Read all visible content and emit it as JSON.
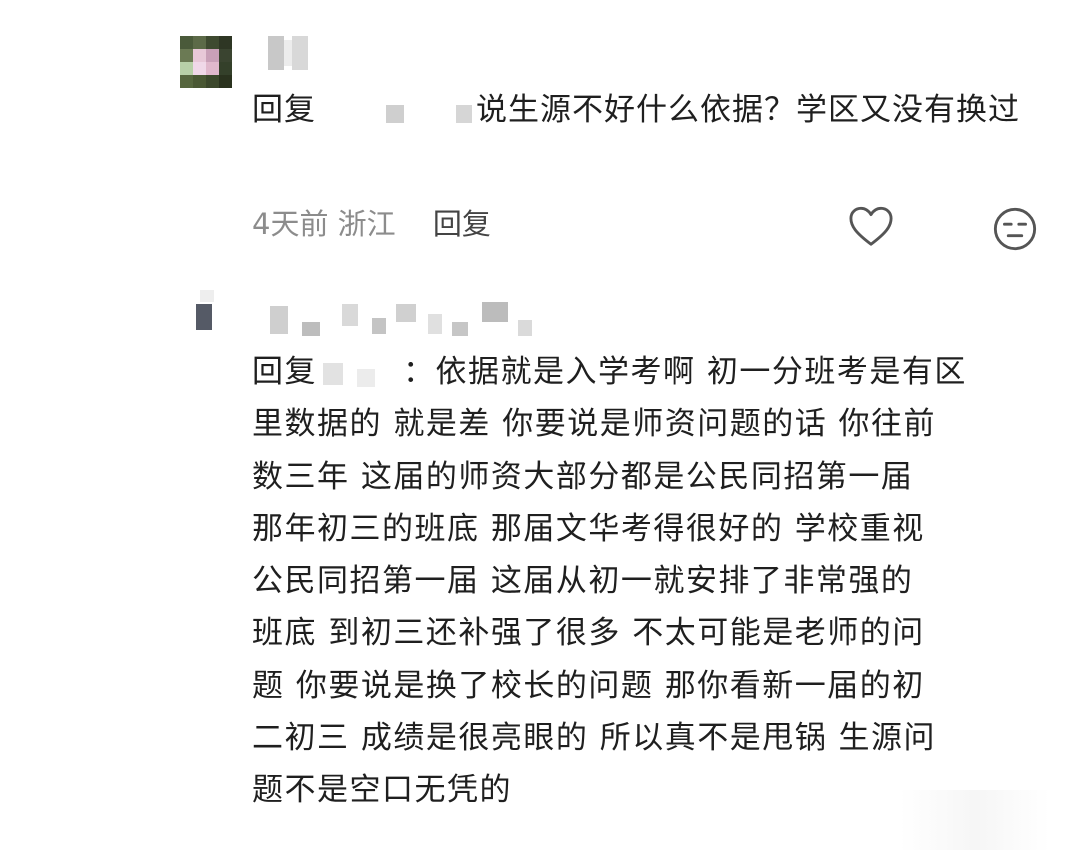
{
  "comments": [
    {
      "reply_prefix": "回复",
      "text": "说生源不好什么依据？学区又没有换过",
      "time": "4天前",
      "location": "浙江",
      "reply_label": "回复",
      "like_icon": "heart-icon",
      "dislike_icon": "dislike-face-icon"
    },
    {
      "reply_prefix": "回复",
      "lines": [
        "：依据就是入学考啊 初一分班考是有区",
        "里数据的 就是差 你要说是师资问题的话 你往前",
        "数三年 这届的师资大部分都是公民同招第一届",
        "那年初三的班底 那届文华考得很好的 学校重视",
        "公民同招第一届 这届从初一就安排了非常强的",
        "班底 到初三还补强了很多 不太可能是老师的问",
        "题 你要说是换了校长的问题 那你看新一届的初",
        "二初三 成绩是很亮眼的 所以真不是甩锅 生源问",
        "题不是空口无凭的"
      ]
    }
  ],
  "colors": {
    "text": "#1f1f1f",
    "meta": "#8c8c8c",
    "icon": "#555555"
  }
}
